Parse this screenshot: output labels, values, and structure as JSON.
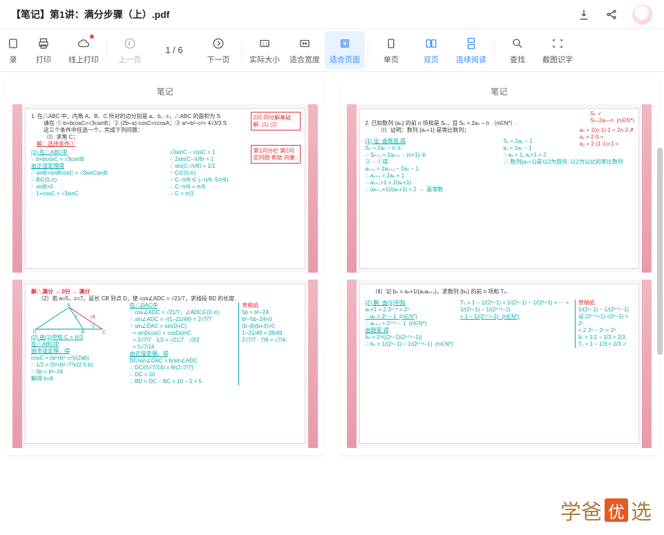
{
  "titlebar": {
    "title": "【笔记】第1讲：满分步骤（上）.pdf"
  },
  "toolbar": {
    "record_label": "录",
    "print_label": "打印",
    "online_print_label": "线上打印",
    "prev_label": "上一页",
    "page_indicator": "1 / 6",
    "next_label": "下一页",
    "actual_size_label": "实际大小",
    "fit_width_label": "适合宽度",
    "fit_page_label": "适合页面",
    "single_page_label": "单页",
    "double_page_label": "双页",
    "continuous_label": "连续阅读",
    "search_label": "查找",
    "screenshot_ocr_label": "截图识字"
  },
  "pages": {
    "header_label": "笔记",
    "p1a": {
      "q_prefix": "1.",
      "q_body": "在△ABC 中，内角 A、B、C 所对的边分别是 a、b、c，△ABC 的面积为 S.",
      "q_sub": "请在 ① b+bcosC=√3csinB；② (2b−a)·cosC=ccosA；③ a²+b²−c²= 4√3/3 S",
      "q_cond": "这三个条件中任选一个，完成下列问题：",
      "q_i": "（Ⅰ）求角 C；",
      "sol_label": "解：选择条件①",
      "step1_head": "(1) 在△ABC中",
      "step1a": "∵ b+bcosC = √3csinB",
      "step1b": "由正弦定理得",
      "step1c": "∴ sinB+sinBcosC = √3sinCsinB",
      "step1d": "∵ B∈(0,π)",
      "step1e": "∴ sinB>0",
      "step1f": "∴ 1+cosC = √3sinC",
      "right1": "√3sinC − cosC = 1",
      "right2": "∴ 2sin(C−π/6) = 1",
      "right3": "∴ sin(C−π/6) = 1/2",
      "right4": "∵ C∈(0,π)",
      "right5": "∴ C−π/6 ∈ (−π/6, 5π/6)",
      "right6": "∴ C−π/6 = π/6",
      "right7": "∴ C = π/3",
      "redbox1": "2问 同分解基础\n解: (1)\n    (2)",
      "redbox2": "第1问分栏 第2问\n定同题\n 帮助\n向案:"
    },
    "p1b": {
      "top_red": "解∴满分 → 0分 → 满分",
      "q_ii": "（2）若 a=5，c=7，延长 CB 到点 D，使 cos∠ADC = √21/7，求线段 BD 的长度.",
      "tri_labels": "A  B  C  D  5  7  √8",
      "l2_head": "(2) 由(1)中知 C = π/3",
      "l2_a": "在△ABC中",
      "l2_b": "由余弦定理，得",
      "l2_c": "cosC = (a²+b²−c²)/(2ab)",
      "l2_d": "∴ 1/2 = (5²+b²−7²)/(2·5·b)",
      "l2_e": "∴ 5b = b²−24",
      "l2_f": "解得 b=8",
      "r2_head": "在△DAC中",
      "r2_a": "∵ cos∠ADC = √21/7，∠ADC∈(0,π)",
      "r2_b": "∴ sin∠ADC = √(1−21/49) = 2√7/7",
      "r2_c": "∵ sin∠DAC = sin(D+C)",
      "r2_d": "  = sinDcosC + cosDsinC",
      "r2_e": "  = 2√7/7 · 1/2 + √21/7 · √3/2",
      "r2_f": "  = 5√7/14",
      "r2_g": "由正弦定理，得",
      "r2_h": "DC/sin∠DAC = b/sin∠ADC",
      "r2_i": "∴ DC/(5√7/14) = 8/(2√7/7)",
      "r2_j": "∴ DC = 10",
      "r2_k": "∴ BD = DC − BC = 10 − 5 = 5",
      "far_head": "草稿纸",
      "far_a": "5b = b²−24",
      "far_b": "b²−5b−24=0",
      "far_c": "(b−8)(b+3)=0",
      "far_d": "1−21/49 = 28/49",
      "far_e": "2√7/7 · 7/8 = √7/4"
    },
    "p2a": {
      "q_prefix": "2.",
      "q_body": "已知数列 {aₙ} 的前 n 项和是 Sₙ，且 Sₙ = 2aₙ − n （n∈N*）.",
      "q_i": "（Ⅰ）证明：数列 {aₙ+1} 是等比数列；",
      "top_red": "Sₙ ✓\nSₙ₌2aₙ−n  (n∈N*)",
      "sol_label": "(1) 证: 由题意,得",
      "step_a": "Sₙ = 2aₙ − n ①",
      "step_b": "∴ Sₙ₊₁ = 2aₙ₊₁ − (n+1) ②",
      "step_c": "② − ①得",
      "step_d": "aₙ₊₁ = 2aₙ₊₁ − 2aₙ − 1",
      "step_e": "∴ aₙ₊₁ = 2aₙ + 1",
      "step_f": "∴ aₙ₊₁+1 = 2(aₙ+1)",
      "step_g": "∴ (aₙ₊₁+1)/(aₙ+1) = 2  ← 是常数",
      "r_a": "aₙ = 2(n-1)-1 = 2n-3 ✗",
      "r_b": "a₁ = 2·0 = ",
      "r_c": "a₂ = 2·(1-1)+1 = ",
      "r_d": "S₁ = 2a₁ − 1",
      "r_e": "a₁ = 2a₁ − 1",
      "r_f": "∴ a₁ = 1, a₁+1 = 2",
      "r_g": "∴ 数列{aₙ+1}是以2为首项, 以2为公比的等比数列"
    },
    "p2b": {
      "q_ii": "（Ⅱ）记 bₙ = aₙ+1/(aₙaₙ₊₁)，求数列 {bₙ} 的前 n 项和 Tₙ.",
      "l_head": "(2) 解: 由(1)中知",
      "l_a": "aₙ+1 = 2·2ⁿ⁻¹ = 2ⁿ",
      "l_b": "∴ aₙ = 2ⁿ − 1  (n∈N*)",
      "l_c": "∴ aₙ₊₁ = 2ⁿ⁺¹ − 1  (n∈N*)",
      "l_d": "由题意,得",
      "l_e": "bₙ = 2ⁿ/((2ⁿ−1)(2ⁿ⁺¹−1))",
      "l_f": "∴ bₙ = 1/(2ⁿ−1) − 1/(2ⁿ⁺¹−1)  (n∈N*)",
      "r_a": "Tₙ = 1 − 1/(2²−1) + 1/(2²−1) − 1/(2³−1) + ··· + 1/(2ⁿ−1) − 1/(2ⁿ⁺¹−1)",
      "r_b": "= 1 − 1/(2ⁿ⁺¹−1)  (n∈N*)",
      "far_head": "草稿纸",
      "far_a": "1/(2ⁿ−1) − 1/(2ⁿ⁺¹−1)",
      "far_b": "设 (2ⁿ⁺¹−1)−(2ⁿ−1) = 2ⁿ",
      "far_c": "= 2·2ⁿ − 2ⁿ = 2ⁿ",
      "far_d": "b₁ = 1/1 − 1/3 = 2/3",
      "far_e": "T₁ = 1 − 1/3 = 2/3 ✓"
    }
  },
  "watermark": {
    "t1": "学爸",
    "t2": "优",
    "t3": "选"
  }
}
